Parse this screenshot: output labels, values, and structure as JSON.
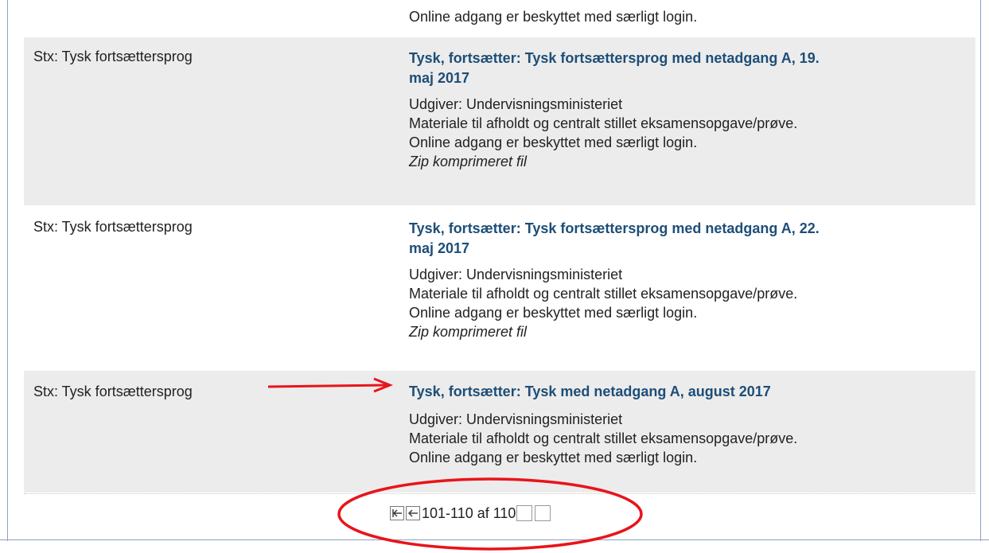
{
  "top_fragment": "Online adgang er beskyttet med særligt login.",
  "rows": [
    {
      "category": "Stx: Tysk fortsættersprog",
      "title_line1": "Tysk, fortsætter: Tysk fortsættersprog med netadgang A, 19.",
      "title_line2": "maj 2017",
      "publisher": "Udgiver: Undervisningsministeriet",
      "material": "Materiale til afholdt og centralt stillet eksamensopgave/prøve.",
      "access": "Online adgang er beskyttet med særligt login.",
      "filetype": "Zip komprimeret fil"
    },
    {
      "category": "Stx: Tysk fortsættersprog",
      "title_line1": "Tysk, fortsætter: Tysk fortsættersprog med netadgang A, 22.",
      "title_line2": "maj 2017",
      "publisher": "Udgiver: Undervisningsministeriet",
      "material": "Materiale til afholdt og centralt stillet eksamensopgave/prøve.",
      "access": "Online adgang er beskyttet med særligt login.",
      "filetype": "Zip komprimeret fil"
    },
    {
      "category": "Stx: Tysk fortsættersprog",
      "title_line1": "Tysk, fortsætter: Tysk med netadgang A, august 2017",
      "publisher": "Udgiver: Undervisningsministeriet",
      "material": "Materiale til afholdt og centralt stillet eksamensopgave/prøve.",
      "access": "Online adgang er beskyttet med særligt login."
    }
  ],
  "pager": {
    "first_icon": "first-page-icon",
    "prev_icon": "prev-page-icon",
    "range_text": "101-110 af 110"
  },
  "colors": {
    "link": "#1d4e78",
    "row_shade": "#ececec",
    "annotation": "#e8141b"
  }
}
